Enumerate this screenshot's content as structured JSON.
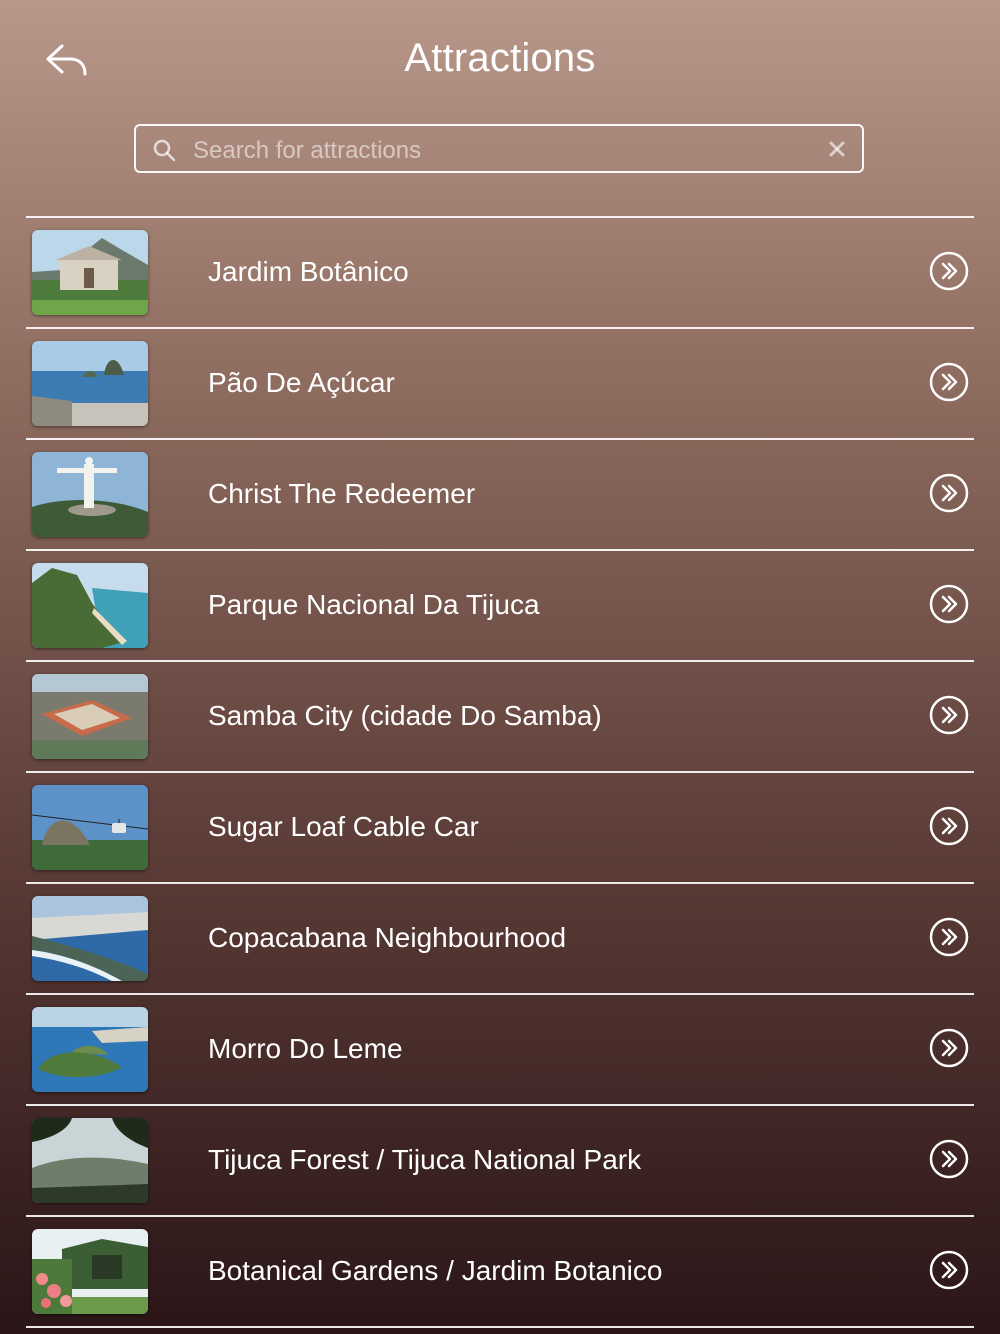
{
  "header": {
    "title": "Attractions",
    "back_icon": "back-arrow-icon"
  },
  "search": {
    "placeholder": "Search for attractions",
    "value": ""
  },
  "attractions": [
    {
      "name": "Jardim Botânico",
      "thumb": "palace-mountain"
    },
    {
      "name": "Pão De Açúcar",
      "thumb": "bay-aerial"
    },
    {
      "name": "Christ The Redeemer",
      "thumb": "statue"
    },
    {
      "name": "Parque Nacional Da Tijuca",
      "thumb": "coast-mountain"
    },
    {
      "name": "Samba City (cidade Do Samba)",
      "thumb": "aerial-complex"
    },
    {
      "name": "Sugar Loaf Cable Car",
      "thumb": "cable-car"
    },
    {
      "name": "Copacabana Neighbourhood",
      "thumb": "peninsula-city"
    },
    {
      "name": "Morro Do Leme",
      "thumb": "island-bay"
    },
    {
      "name": "Tijuca Forest / Tijuca National Park",
      "thumb": "forest"
    },
    {
      "name": "Botanical Gardens / Jardim Botanico",
      "thumb": "garden-flowers"
    }
  ]
}
